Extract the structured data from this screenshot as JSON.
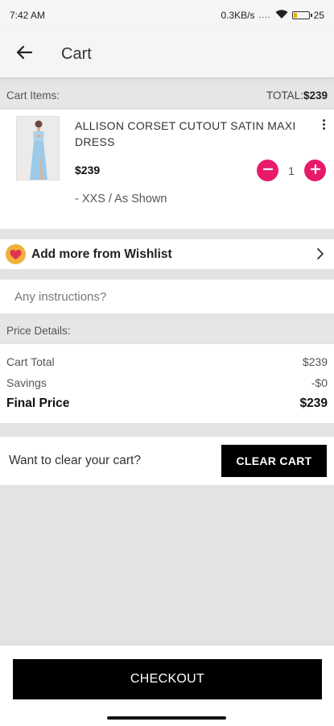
{
  "status_bar": {
    "time": "7:42 AM",
    "network_speed": "0.3KB/s",
    "dots": "....",
    "battery": "25",
    "battery_fraction": 0.25,
    "icons": [
      "wifi-icon",
      "battery-icon"
    ]
  },
  "app_bar": {
    "title": "Cart",
    "back_icon": "arrow-left-icon"
  },
  "cart_header": {
    "label": "Cart Items:",
    "total_label": "TOTAL:",
    "total_value": "$239"
  },
  "cart_items": [
    {
      "name": "ALLISON CORSET CUTOUT SATIN MAXI DRESS",
      "price": "$239",
      "quantity": "1",
      "variant": "- XXS / As Shown",
      "image": "light blue satin dress",
      "menu_icon": "kebab-menu-icon"
    }
  ],
  "wishlist": {
    "label": "Add more from Wishlist",
    "icon": "heart-icon",
    "chevron_icon": "chevron-right-icon"
  },
  "instructions": {
    "placeholder": "Any instructions?",
    "value": ""
  },
  "price_details": {
    "header": "Price Details:",
    "rows": [
      {
        "label": "Cart Total",
        "value": "$239"
      },
      {
        "label": "Savings",
        "value": "-$0"
      }
    ],
    "final": {
      "label": "Final Price",
      "value": "$239"
    }
  },
  "clear_cart": {
    "prompt": "Want to clear your cart?",
    "button": "CLEAR CART"
  },
  "checkout": {
    "button": "CHECKOUT"
  },
  "colors": {
    "accent": "#e8196b",
    "heart_badge": "#f0b23c",
    "primary_button": "#000000"
  }
}
